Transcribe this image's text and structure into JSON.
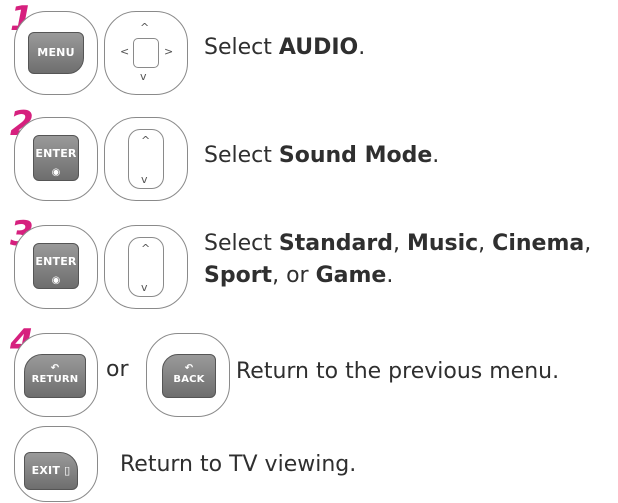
{
  "steps": [
    {
      "number": "1",
      "key_label": "MENU",
      "text_prefix": "Select ",
      "text_bold": "AUDIO",
      "text_suffix": "."
    },
    {
      "number": "2",
      "key_label": "ENTER",
      "text_prefix": "Select ",
      "text_bold": "Sound Mode",
      "text_suffix": "."
    },
    {
      "number": "3",
      "key_label": "ENTER",
      "line1_prefix": "Select ",
      "opt1": "Standard",
      "sep1": ", ",
      "opt2": "Music",
      "sep2": ", ",
      "opt3": "Cinema",
      "sep3": ",",
      "opt4": "Sport",
      "sep4": ", or ",
      "opt5": "Game",
      "end": "."
    },
    {
      "number": "4",
      "key1_label": "RETURN",
      "or_text": "or",
      "key2_label": "BACK",
      "text": "Return to the previous menu."
    }
  ],
  "exit": {
    "key_label": "EXIT",
    "text": "Return to TV viewing."
  },
  "colors": {
    "step_number": "#d6207e",
    "key_fill": "#7f7f7f"
  }
}
